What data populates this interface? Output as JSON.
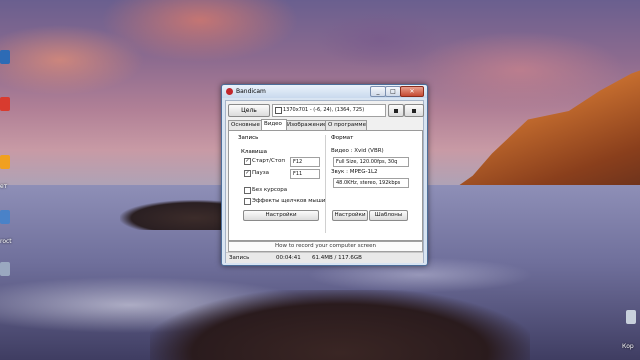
{
  "window": {
    "title": "Bandicam",
    "app_icon": "bandicam-logo-icon",
    "controls": {
      "minimize": "_",
      "maximize": "□",
      "close": "✕"
    }
  },
  "toolbar": {
    "target_label": "Цель",
    "capture_size": "1370x701 - (-6, 24), (1364, 725)",
    "pause_icon": "stop-square-icon",
    "record_icon": "record-square-icon"
  },
  "tabs": [
    {
      "label": "Основные",
      "active": false
    },
    {
      "label": "Видео",
      "active": true
    },
    {
      "label": "Изображение",
      "active": false
    },
    {
      "label": "О программе",
      "active": false
    }
  ],
  "recording": {
    "group_title": "Запись",
    "hotkey_title": "Клавиша",
    "hotkeys": [
      {
        "label": "Старт/Стоп",
        "checked": true,
        "key": "F12"
      },
      {
        "label": "Пауза",
        "checked": true,
        "key": "F11"
      }
    ],
    "options": [
      {
        "label": "Без курсора",
        "checked": false
      },
      {
        "label": "Эффекты щелчков мыши",
        "checked": false
      }
    ],
    "settings_button": "Настройки"
  },
  "format": {
    "group_title": "Формат",
    "video_label": "Видео : Xvid (VBR)",
    "video_value": "Full Size, 120.00fps, 30q",
    "audio_label": "Звук : MPEG-1L2",
    "audio_value": "48.0KHz, stereo, 192kbps",
    "settings_button": "Настройки",
    "templates_button": "Шаблоны"
  },
  "banner": "How to record your computer screen",
  "status": {
    "state": "Запись",
    "elapsed": "00:04:41",
    "file_size": "61.4MB / 117.6GB"
  },
  "desktop": {
    "icon_labels": [
      "ет",
      "roct"
    ],
    "tray_text": "Кор"
  }
}
